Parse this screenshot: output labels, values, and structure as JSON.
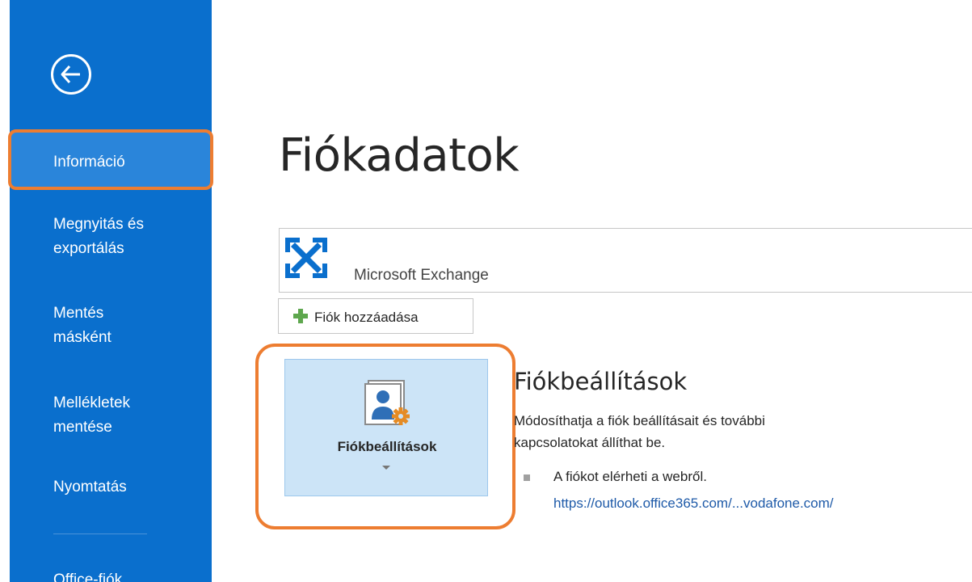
{
  "sidebar": {
    "back_icon": "back-arrow-icon",
    "items": [
      {
        "label": "Információ",
        "active": true
      },
      {
        "label_line1": "Megnyitás és",
        "label_line2": "exportálás"
      },
      {
        "label_line1": "Mentés",
        "label_line2": "másként"
      },
      {
        "label_line1": "Mellékletek",
        "label_line2": "mentése"
      },
      {
        "label": "Nyomtatás"
      },
      {
        "label": "Office-fiók"
      }
    ],
    "colors": {
      "background": "#0a6fcd",
      "active": "#2a85da",
      "highlight": "#ed7d31"
    }
  },
  "main": {
    "title": "Fiókadatok",
    "account": {
      "icon": "exchange-icon",
      "name": "Microsoft Exchange"
    },
    "add_account": {
      "icon": "plus-icon",
      "label": "Fiók hozzáadása"
    },
    "settings_tile": {
      "icon": "account-settings-icon",
      "label": "Fiókbeállítások",
      "caret_icon": "dropdown-caret-icon"
    },
    "section": {
      "title": "Fiókbeállítások",
      "description": "Módosíthatja a fiók beállításait és további kapcsolatokat állíthat be.",
      "web_access_text": "A fiókot elérheti a webről.",
      "web_link": "https://outlook.office365.com/...vodafone.com/"
    }
  }
}
